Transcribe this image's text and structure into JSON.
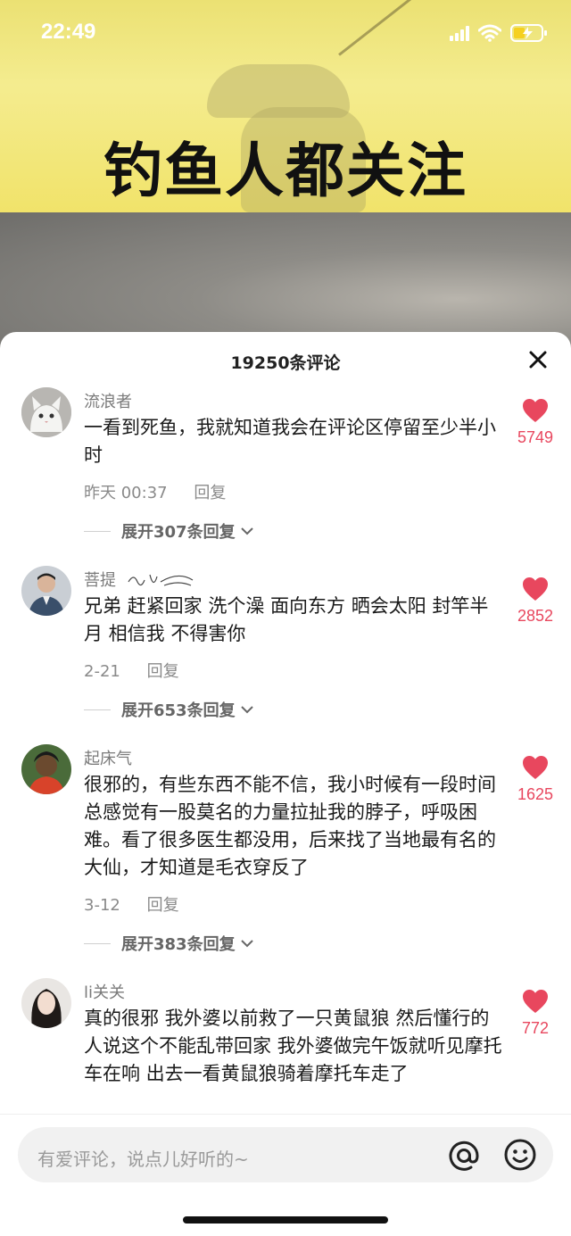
{
  "status_bar": {
    "time": "22:49"
  },
  "video": {
    "title_text": "钓鱼人都关注"
  },
  "comments_sheet": {
    "count_label": "19250条评论",
    "comments": [
      {
        "username": "流浪者",
        "text": "一看到死鱼，我就知道我会在评论区停留至少半小时",
        "time": "昨天 00:37",
        "reply_label": "回复",
        "likes": "5749",
        "expand_label": "展开307条回复"
      },
      {
        "username": "菩提",
        "text": "兄弟 赶紧回家 洗个澡 面向东方 晒会太阳 封竿半月 相信我 不得害你",
        "time": "2-21",
        "reply_label": "回复",
        "likes": "2852",
        "expand_label": "展开653条回复"
      },
      {
        "username": "起床气",
        "text": "很邪的，有些东西不能不信，我小时候有一段时间总感觉有一股莫名的力量拉扯我的脖子，呼吸困难。看了很多医生都没用，后来找了当地最有名的大仙，才知道是毛衣穿反了",
        "time": "3-12",
        "reply_label": "回复",
        "likes": "1625",
        "expand_label": "展开383条回复"
      },
      {
        "username": "li关关",
        "text": "真的很邪 我外婆以前救了一只黄鼠狼 然后懂行的人说这个不能乱带回家 我外婆做完午饭就听见摩托车在响 出去一看黄鼠狼骑着摩托车走了",
        "likes": "772"
      }
    ]
  },
  "input_bar": {
    "placeholder": "有爱评论，说点儿好听的~"
  },
  "colors": {
    "like_red": "#e8475e",
    "sheet_bg": "#ffffff",
    "banner_yellow": "#f1e36a"
  }
}
